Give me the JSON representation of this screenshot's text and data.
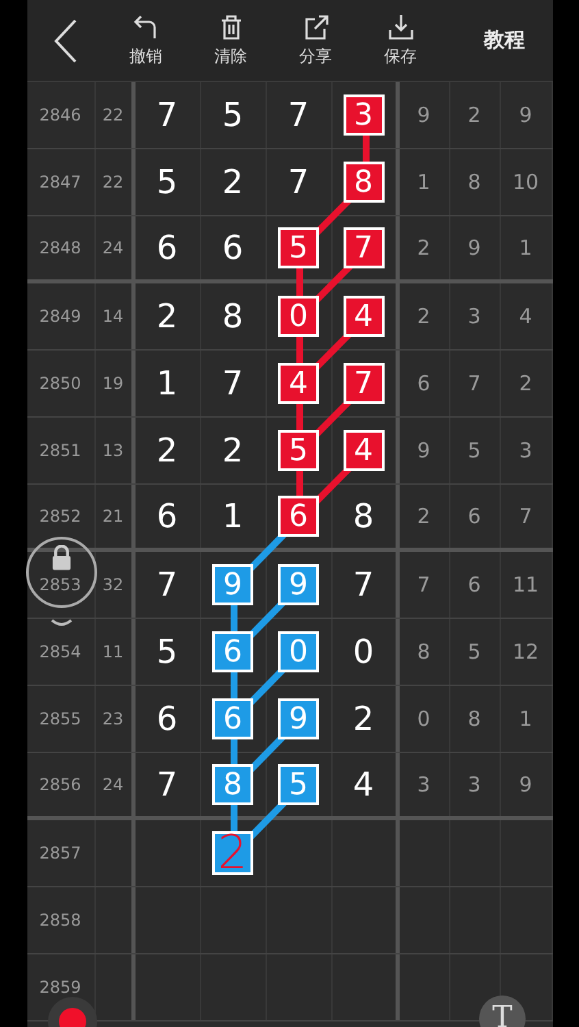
{
  "toolbar": {
    "buttons": [
      {
        "kind": "undo",
        "label": "撤销"
      },
      {
        "kind": "clear",
        "label": "清除"
      },
      {
        "kind": "share",
        "label": "分享"
      },
      {
        "kind": "save",
        "label": "保存"
      }
    ],
    "tutorial": "教程"
  },
  "rows": [
    {
      "issue": "2846",
      "sum": "22",
      "group_end": false,
      "digits": [
        {
          "value": "7",
          "kind": "plain"
        },
        {
          "value": "5",
          "kind": "plain"
        },
        {
          "value": "7",
          "kind": "plain"
        },
        {
          "value": "3",
          "kind": "red"
        }
      ],
      "stats": [
        "9",
        "2",
        "9"
      ]
    },
    {
      "issue": "2847",
      "sum": "22",
      "group_end": false,
      "digits": [
        {
          "value": "5",
          "kind": "plain"
        },
        {
          "value": "2",
          "kind": "plain"
        },
        {
          "value": "7",
          "kind": "plain"
        },
        {
          "value": "8",
          "kind": "red"
        }
      ],
      "stats": [
        "1",
        "8",
        "10"
      ]
    },
    {
      "issue": "2848",
      "sum": "24",
      "group_end": true,
      "digits": [
        {
          "value": "6",
          "kind": "plain"
        },
        {
          "value": "6",
          "kind": "plain"
        },
        {
          "value": "5",
          "kind": "red"
        },
        {
          "value": "7",
          "kind": "red"
        }
      ],
      "stats": [
        "2",
        "9",
        "1"
      ]
    },
    {
      "issue": "2849",
      "sum": "14",
      "group_end": false,
      "digits": [
        {
          "value": "2",
          "kind": "plain"
        },
        {
          "value": "8",
          "kind": "plain"
        },
        {
          "value": "0",
          "kind": "red"
        },
        {
          "value": "4",
          "kind": "red"
        }
      ],
      "stats": [
        "2",
        "3",
        "4"
      ]
    },
    {
      "issue": "2850",
      "sum": "19",
      "group_end": false,
      "digits": [
        {
          "value": "1",
          "kind": "plain"
        },
        {
          "value": "7",
          "kind": "plain"
        },
        {
          "value": "4",
          "kind": "red"
        },
        {
          "value": "7",
          "kind": "red"
        }
      ],
      "stats": [
        "6",
        "7",
        "2"
      ]
    },
    {
      "issue": "2851",
      "sum": "13",
      "group_end": false,
      "digits": [
        {
          "value": "2",
          "kind": "plain"
        },
        {
          "value": "2",
          "kind": "plain"
        },
        {
          "value": "5",
          "kind": "red"
        },
        {
          "value": "4",
          "kind": "red"
        }
      ],
      "stats": [
        "9",
        "5",
        "3"
      ]
    },
    {
      "issue": "2852",
      "sum": "21",
      "group_end": true,
      "digits": [
        {
          "value": "6",
          "kind": "plain"
        },
        {
          "value": "1",
          "kind": "plain"
        },
        {
          "value": "6",
          "kind": "red"
        },
        {
          "value": "8",
          "kind": "plain"
        }
      ],
      "stats": [
        "2",
        "6",
        "7"
      ]
    },
    {
      "issue": "2853",
      "sum": "32",
      "group_end": false,
      "digits": [
        {
          "value": "7",
          "kind": "plain"
        },
        {
          "value": "9",
          "kind": "blue"
        },
        {
          "value": "9",
          "kind": "blue"
        },
        {
          "value": "7",
          "kind": "plain"
        }
      ],
      "stats": [
        "7",
        "6",
        "11"
      ]
    },
    {
      "issue": "2854",
      "sum": "11",
      "group_end": false,
      "digits": [
        {
          "value": "5",
          "kind": "plain"
        },
        {
          "value": "6",
          "kind": "blue"
        },
        {
          "value": "0",
          "kind": "blue"
        },
        {
          "value": "0",
          "kind": "plain"
        }
      ],
      "stats": [
        "8",
        "5",
        "12"
      ]
    },
    {
      "issue": "2855",
      "sum": "23",
      "group_end": false,
      "digits": [
        {
          "value": "6",
          "kind": "plain"
        },
        {
          "value": "6",
          "kind": "blue"
        },
        {
          "value": "9",
          "kind": "blue"
        },
        {
          "value": "2",
          "kind": "plain"
        }
      ],
      "stats": [
        "0",
        "8",
        "1"
      ]
    },
    {
      "issue": "2856",
      "sum": "24",
      "group_end": true,
      "digits": [
        {
          "value": "7",
          "kind": "plain"
        },
        {
          "value": "8",
          "kind": "blue"
        },
        {
          "value": "5",
          "kind": "blue"
        },
        {
          "value": "4",
          "kind": "plain"
        }
      ],
      "stats": [
        "3",
        "3",
        "9"
      ]
    },
    {
      "issue": "2857",
      "group_end": false,
      "digits": [
        {
          "kind": "empty"
        },
        {
          "value": "2",
          "kind": "pen"
        },
        {
          "kind": "empty"
        },
        {
          "kind": "empty"
        }
      ],
      "stats": []
    },
    {
      "issue": "2858",
      "group_end": false,
      "digits": [
        {
          "kind": "empty"
        },
        {
          "kind": "empty"
        },
        {
          "kind": "empty"
        },
        {
          "kind": "empty"
        }
      ],
      "stats": []
    },
    {
      "issue": "2859",
      "group_end": false,
      "digits": [
        {
          "kind": "empty"
        },
        {
          "kind": "empty"
        },
        {
          "kind": "empty"
        },
        {
          "kind": "empty"
        }
      ],
      "stats": []
    }
  ],
  "text_tool": "T"
}
